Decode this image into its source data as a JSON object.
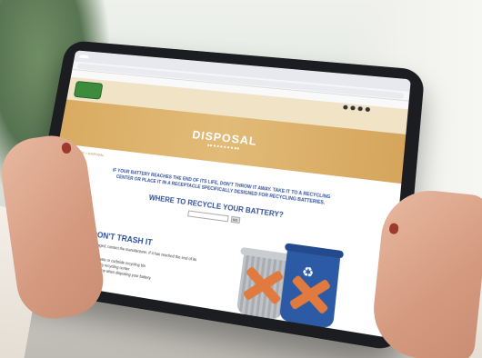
{
  "browser": {
    "tab_label": "",
    "url": ""
  },
  "site": {
    "logo_line1": "",
    "logo_line2": "",
    "nav_items": [
      "",
      "",
      "",
      "",
      ""
    ],
    "hero_title": "DISPOSAL",
    "breadcrumb": "HOME > DISPOSAL",
    "lead_text": "IF YOUR BATTERY REACHES THE END OF ITS LIFE, DON'T THROW IT AWAY. TAKE IT TO A RECYCLING CENTER OR PLACE IT IN A RECEPTACLE SPECIFICALLY DESIGNED FOR RECYCLING BATTERIES.",
    "where_title": "WHERE TO RECYCLE YOUR BATTERY?",
    "go_label": "GO",
    "trash_title": "DON'T TRASH IT",
    "trash_intro": "If your battery is damaged, contact the manufacturer. If it has reached the end of its life:",
    "trash_bullets": [
      "Never throw it in a waste or curbside recycling bin",
      "Take it to a local battery recycling center",
      "Always follow regulations when disposing your battery"
    ]
  },
  "colors": {
    "hero_bg": "#d9ab62",
    "heading_blue": "#2f4f9a",
    "logo_green": "#3d8b3d",
    "bin_blue": "#2d5aa5",
    "x_orange": "#e07a3e"
  }
}
